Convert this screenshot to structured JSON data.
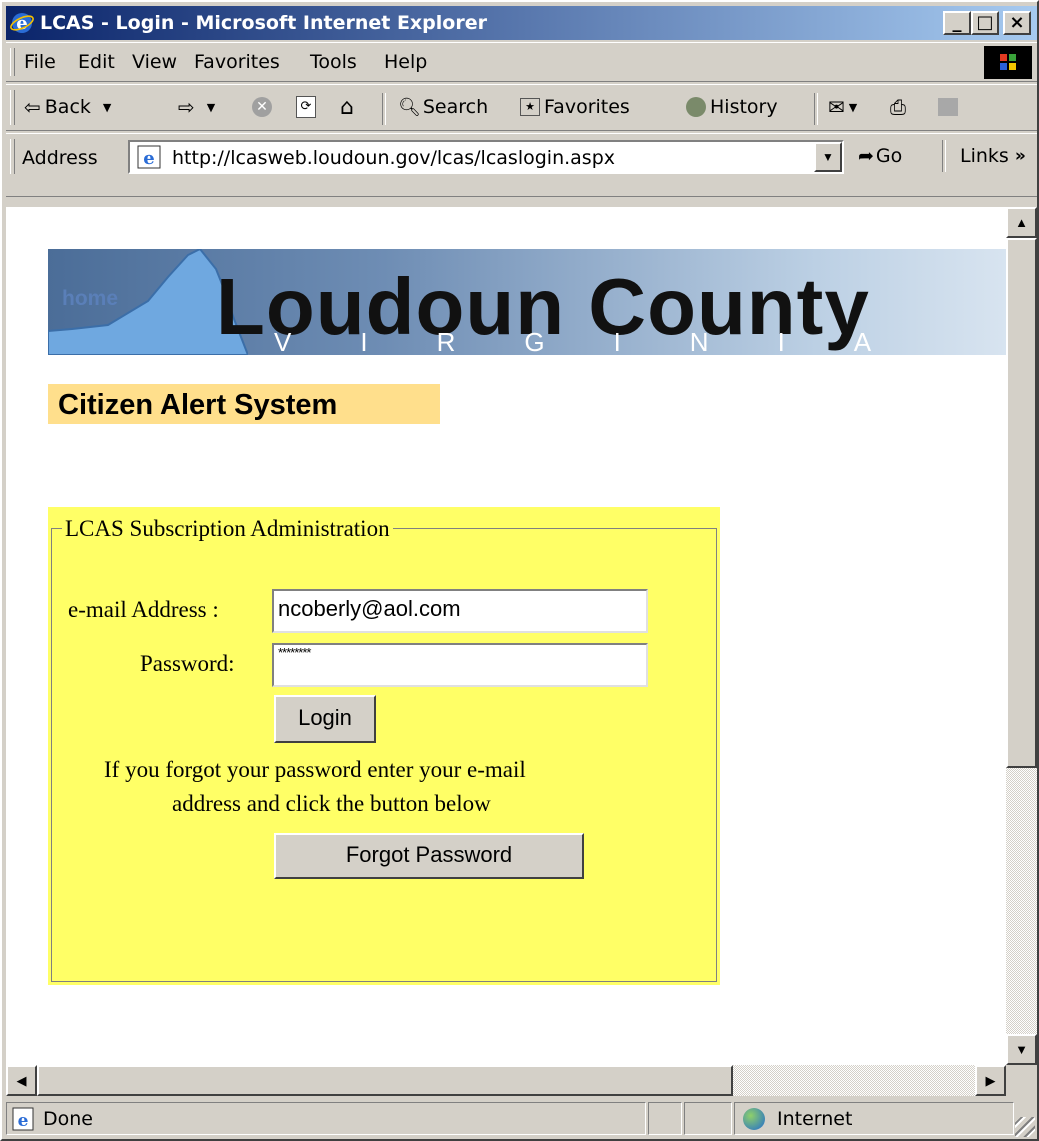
{
  "window": {
    "title": "LCAS - Login - Microsoft Internet Explorer"
  },
  "menu": [
    "File",
    "Edit",
    "View",
    "Favorites",
    "Tools",
    "Help"
  ],
  "toolbar": {
    "back": "Back",
    "search": "Search",
    "favorites": "Favorites",
    "history": "History"
  },
  "address": {
    "label": "Address",
    "url": "http://lcasweb.loudoun.gov/lcas/lcaslogin.aspx",
    "go": "Go",
    "links": "Links"
  },
  "banner": {
    "home": "home",
    "title": "Loudoun County",
    "subtitle": "VIRGINIA"
  },
  "heading": "Citizen Alert System",
  "form": {
    "legend": "LCAS Subscription Administration",
    "email_label": "e-mail Address :",
    "email_value": "ncoberly@aol.com",
    "password_label": "Password:",
    "password_value": "********",
    "login_button": "Login",
    "forgot_text_1": "If you forgot your password enter your e-mail",
    "forgot_text_2": "address and click the button below",
    "forgot_button": "Forgot Password"
  },
  "status": {
    "text": "Done",
    "zone": "Internet"
  },
  "colors": {
    "form_bg": "#ffff66",
    "heading_bg": "#ffdf8c",
    "titlebar": "#0a246a"
  }
}
